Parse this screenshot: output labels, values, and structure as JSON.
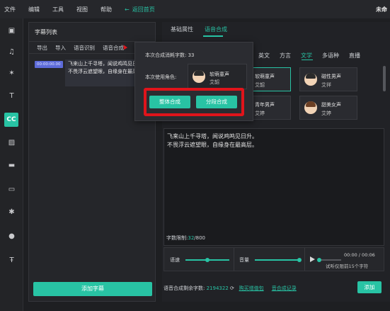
{
  "menu": {
    "items": [
      "文件",
      "编辑",
      "工具",
      "视图",
      "帮助"
    ],
    "back_label": "返回首页",
    "project_name": "未命"
  },
  "rail": {
    "icons": [
      "media-icon",
      "music-icon",
      "effects-icon",
      "text-icon",
      "subtitle-icon",
      "filter-icon",
      "folder-icon",
      "comment-icon",
      "magic-icon",
      "person-icon",
      "text-to-speech-icon"
    ],
    "active_label": "CC"
  },
  "subtitle_panel": {
    "title": "字幕列表",
    "tabs": [
      "导出",
      "导入",
      "语音识别",
      "语音合成"
    ],
    "item": {
      "time": "00:00:00.00",
      "text": "飞来山上千寻塔，闻说鸡鸣见日升。不畏浮云遮望眼，自缘身在最高层。"
    },
    "add_button": "添加字幕"
  },
  "right_panel": {
    "tabs": [
      "基础属性",
      "语音合成"
    ],
    "active_tab": "语音合成",
    "languages": [
      "英文",
      "方言",
      "文学",
      "多语种",
      "直播"
    ],
    "active_language": "文学",
    "voices": [
      {
        "name": "软萌童声",
        "sub": "艾韶"
      },
      {
        "name": "磁性男声",
        "sub": "艾祥"
      },
      {
        "name": "青年男声",
        "sub": "艾婷"
      },
      {
        "name": "甜美女声",
        "sub": "艾婷"
      }
    ],
    "text": "飞来山上千寻塔，闻说鸡鸣见日升。\n不畏浮云遮望眼，自缘身在最高层。",
    "count_label": "字数限制:",
    "count_value": "32",
    "count_max": "/800",
    "speed_label": "语速",
    "volume_label": "音量",
    "time": "00:00 / 00:06",
    "tip": "试听仅限前15个字符",
    "remaining_label": "语音合成剩余字数:",
    "remaining_value": "2194322",
    "buy_link": "购买增值包",
    "record_link": "音合成记录",
    "add_button": "添加"
  },
  "popup": {
    "cost": "本次合成消耗字数: 33",
    "role_label": "本次使用角色:",
    "voice_name": "软萌童声",
    "voice_sub": "艾韶",
    "btn_whole": "整体合成",
    "btn_segment": "分段合成"
  }
}
